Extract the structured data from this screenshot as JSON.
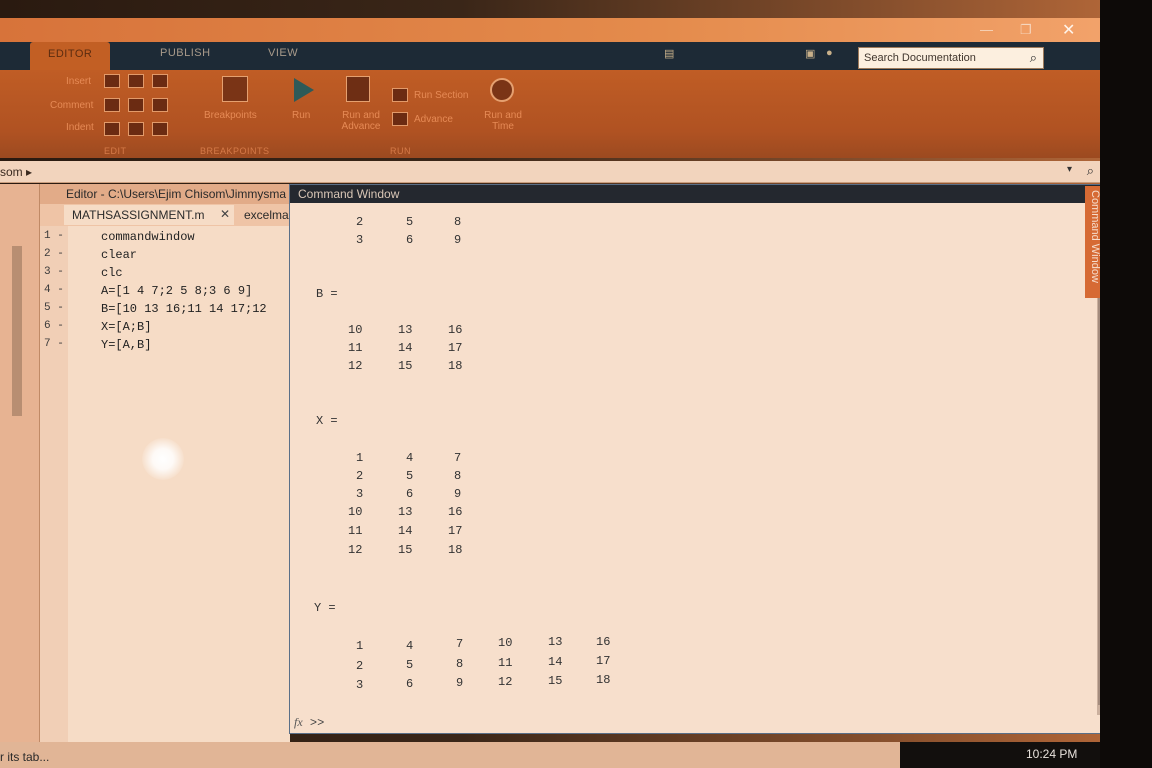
{
  "ribbon": {
    "tabs": [
      "EDITOR",
      "PUBLISH",
      "VIEW"
    ],
    "search_placeholder": "Search Documentation",
    "labels": {
      "insert": "Insert",
      "comment": "Comment",
      "indent": "Indent",
      "breakpoints": "Breakpoints",
      "run": "Run",
      "run_and_advance": "Run and Advance",
      "run_section": "Run Section",
      "advance": "Advance",
      "run_and_time": "Run and Time"
    },
    "sections": [
      "EDIT",
      "BREAKPOINTS",
      "RUN"
    ]
  },
  "address": {
    "crumb": "som ▸"
  },
  "editor": {
    "title": "Editor - C:\\Users\\Ejim Chisom\\Jimmysma",
    "tabs": [
      "MATHSASSIGNMENT.m",
      "excelma"
    ],
    "lines": [
      {
        "num": "1 -",
        "code": "commandwindow"
      },
      {
        "num": "2 -",
        "code": "clear"
      },
      {
        "num": "3 -",
        "code": "clc"
      },
      {
        "num": "4 -",
        "code": "A=[1 4 7;2 5 8;3 6 9]"
      },
      {
        "num": "5 -",
        "code": "B=[10 13 16;11 14 17;12"
      },
      {
        "num": "6 -",
        "code": "X=[A;B]"
      },
      {
        "num": "7 -",
        "code": "Y=[A,B]"
      }
    ]
  },
  "command_window": {
    "title": "Command Window",
    "side_tab": "Command Window",
    "prompt": ">>",
    "a_tail_rows": [
      [
        "2",
        "5",
        "8"
      ],
      [
        "3",
        "6",
        "9"
      ]
    ],
    "b_label": "B =",
    "b_rows": [
      [
        "10",
        "13",
        "16"
      ],
      [
        "11",
        "14",
        "17"
      ],
      [
        "12",
        "15",
        "18"
      ]
    ],
    "x_label": "X =",
    "x_rows": [
      [
        "1",
        "4",
        "7"
      ],
      [
        "2",
        "5",
        "8"
      ],
      [
        "3",
        "6",
        "9"
      ],
      [
        "10",
        "13",
        "16"
      ],
      [
        "11",
        "14",
        "17"
      ],
      [
        "12",
        "15",
        "18"
      ]
    ],
    "y_label": "Y =",
    "y_rows": [
      [
        "1",
        "4",
        "7",
        "10",
        "13",
        "16"
      ],
      [
        "2",
        "5",
        "8",
        "11",
        "14",
        "17"
      ],
      [
        "3",
        "6",
        "9",
        "12",
        "15",
        "18"
      ]
    ]
  },
  "status": {
    "text": "r its tab...",
    "clock": "10:24 PM"
  }
}
